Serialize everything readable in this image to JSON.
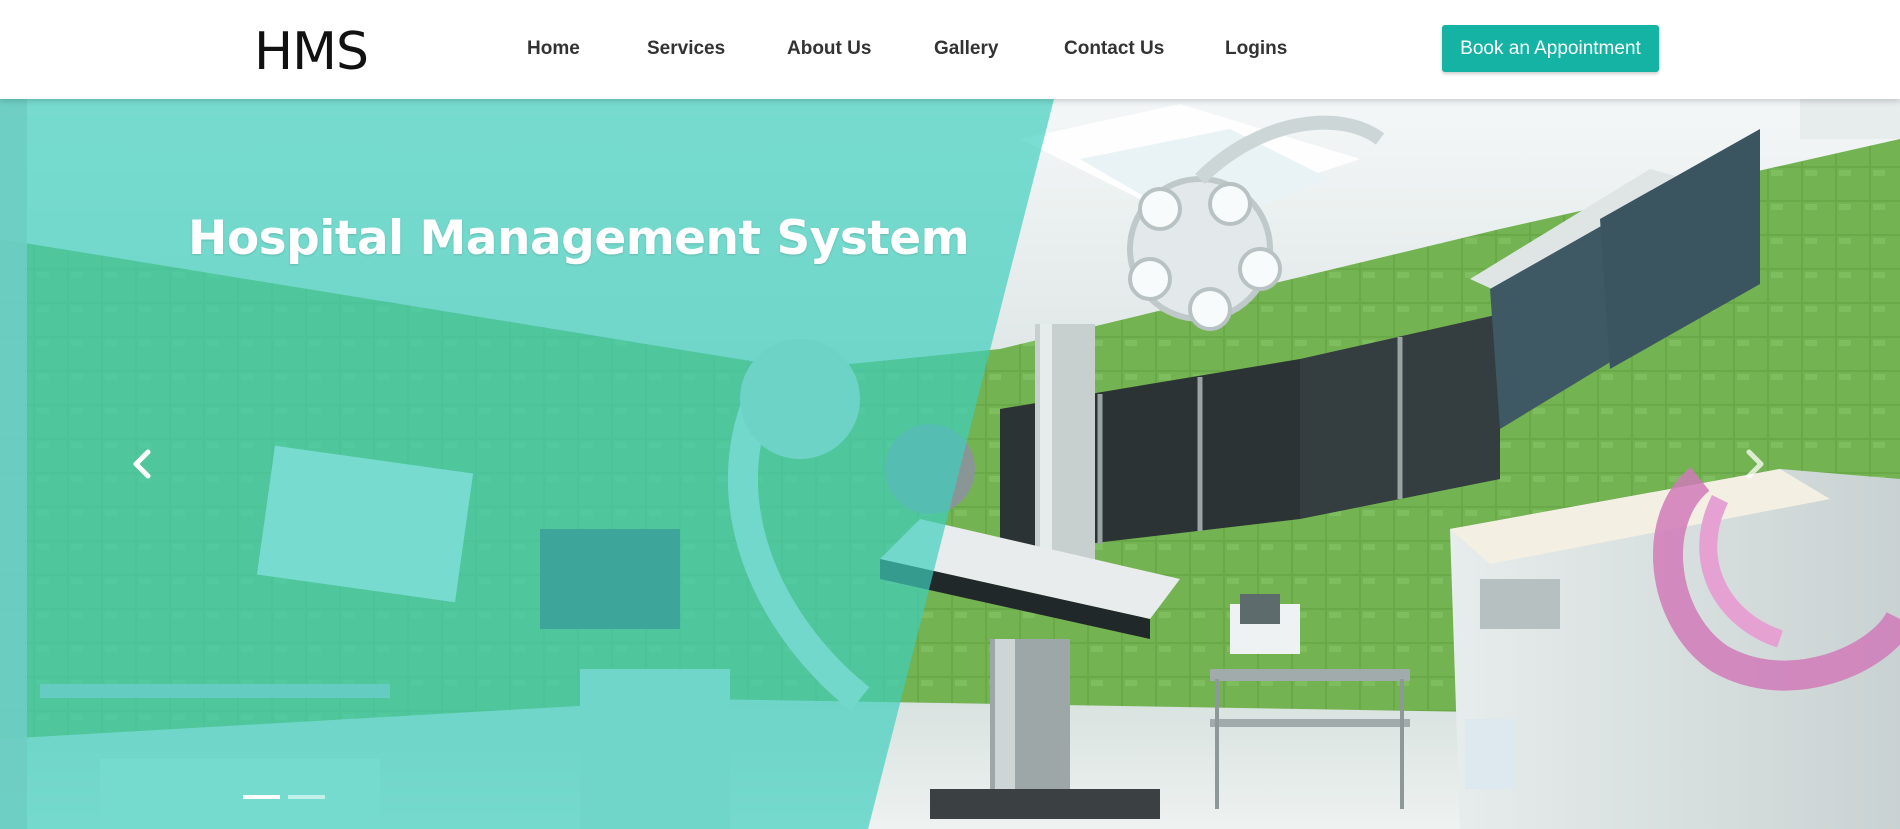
{
  "header": {
    "brand": "HMS",
    "nav": {
      "home": "Home",
      "services": "Services",
      "about": "About Us",
      "gallery": "Gallery",
      "contact": "Contact Us",
      "logins": "Logins"
    },
    "cta_label": "Book an Appointment"
  },
  "hero": {
    "title": "Hospital Management System",
    "prev_icon": "chevron-left-icon",
    "next_icon": "chevron-right-icon",
    "slide_count": 2,
    "active_slide": 1
  },
  "colors": {
    "accent": "#14b3a4",
    "overlay": "#2ac8b6",
    "wall_green": "#6fa94a",
    "nav_text": "#333333",
    "brand_text": "#111111"
  }
}
